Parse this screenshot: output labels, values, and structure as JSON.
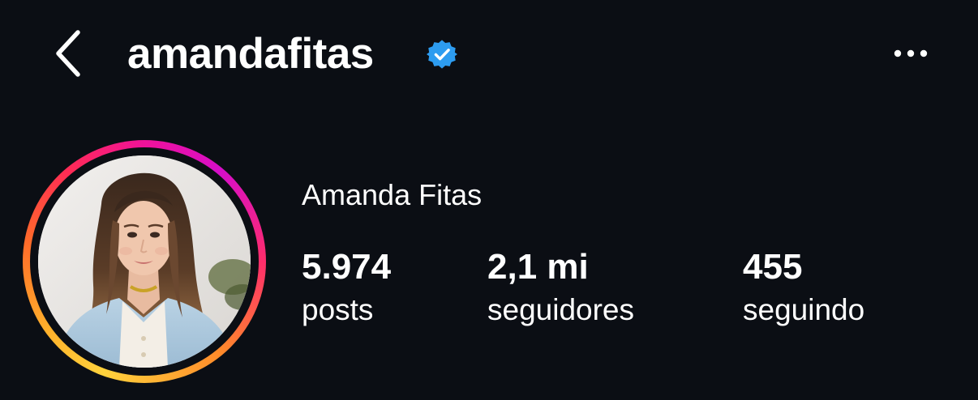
{
  "header": {
    "back_icon": "chevron-left-icon",
    "username": "amandafitas",
    "verified_icon": "verified-badge-icon",
    "more_icon": "more-horizontal-icon"
  },
  "profile": {
    "display_name": "Amanda Fitas",
    "story_ring": true,
    "stats": {
      "posts": {
        "value": "5.974",
        "label": "posts"
      },
      "followers": {
        "value": "2,1 mi",
        "label": "seguidores"
      },
      "following": {
        "value": "455",
        "label": "seguindo"
      }
    }
  },
  "colors": {
    "background": "#0b0e14",
    "text": "#ffffff",
    "verified": "#2d9cf0"
  }
}
